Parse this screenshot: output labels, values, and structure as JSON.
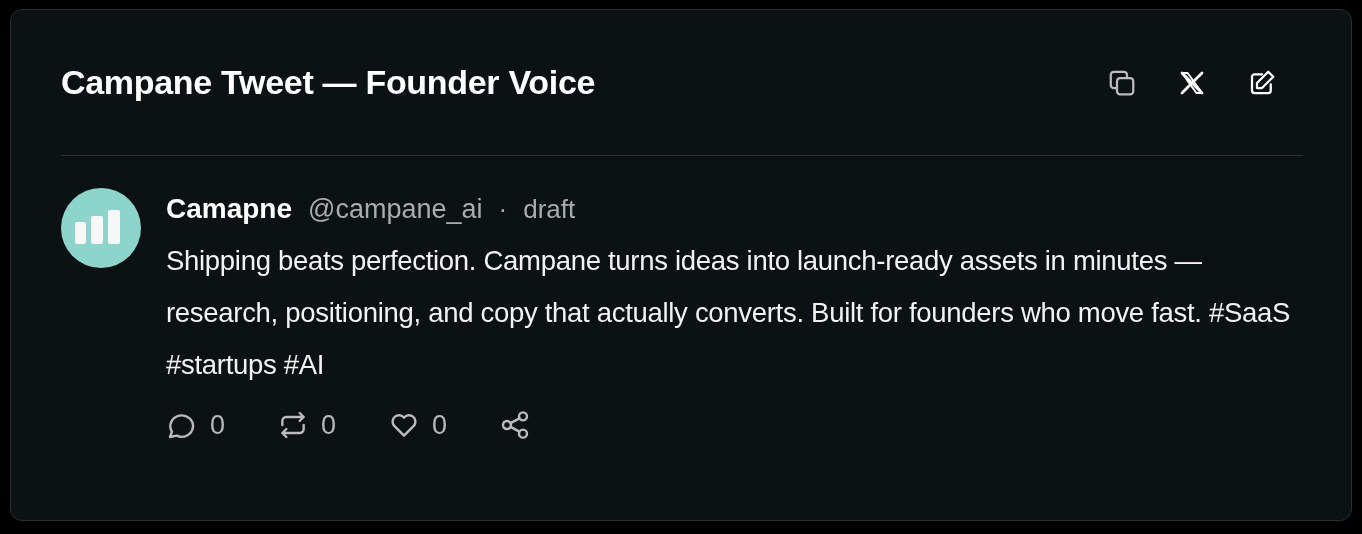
{
  "card": {
    "title": "Campane Tweet — Founder Voice",
    "tools": [
      {
        "kind": "copy"
      },
      {
        "kind": "x"
      },
      {
        "kind": "edit"
      }
    ]
  },
  "tweet": {
    "name": "Camapne",
    "handle": "@campane_ai",
    "separator": "·",
    "status": "draft",
    "text": "Shipping beats perfection. Campane turns ideas into launch-ready assets in minutes — research, positioning, and copy that actually converts. Built for founders who move fast. #SaaS #startups #AI",
    "actions": [
      {
        "kind": "reply",
        "count": "0"
      },
      {
        "kind": "repost",
        "count": "0"
      },
      {
        "kind": "like",
        "count": "0"
      },
      {
        "kind": "share"
      }
    ]
  }
}
